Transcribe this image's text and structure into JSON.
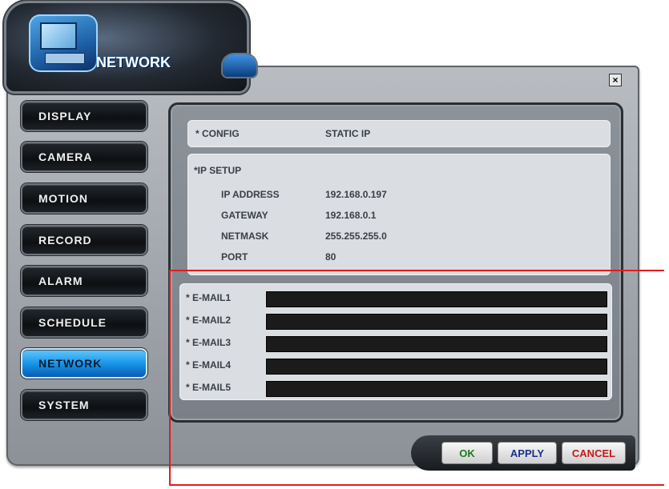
{
  "window": {
    "title": "NETWORK",
    "close_label": "×"
  },
  "sidebar": {
    "items": [
      {
        "label": "DISPLAY",
        "active": false
      },
      {
        "label": "CAMERA",
        "active": false
      },
      {
        "label": "MOTION",
        "active": false
      },
      {
        "label": "RECORD",
        "active": false
      },
      {
        "label": "ALARM",
        "active": false
      },
      {
        "label": "SCHEDULE",
        "active": false
      },
      {
        "label": "NETWORK",
        "active": true
      },
      {
        "label": "SYSTEM",
        "active": false
      }
    ]
  },
  "config": {
    "label": "* CONFIG",
    "value": "STATIC IP"
  },
  "ip_setup": {
    "heading": "*IP SETUP",
    "rows": [
      {
        "label": "IP ADDRESS",
        "value": "192.168.0.197"
      },
      {
        "label": "GATEWAY",
        "value": "192.168.0.1"
      },
      {
        "label": "NETMASK",
        "value": "255.255.255.0"
      },
      {
        "label": "PORT",
        "value": "80"
      }
    ]
  },
  "email": {
    "rows": [
      {
        "label": "* E-MAIL1",
        "value": ""
      },
      {
        "label": "* E-MAIL2",
        "value": ""
      },
      {
        "label": "* E-MAIL3",
        "value": ""
      },
      {
        "label": "* E-MAIL4",
        "value": ""
      },
      {
        "label": "* E-MAIL5",
        "value": ""
      }
    ]
  },
  "buttons": {
    "ok": "OK",
    "apply": "APPLY",
    "cancel": "CANCEL"
  },
  "colors": {
    "active_nav": "#1490e6",
    "ok_text": "#1a7a1a",
    "apply_text": "#1a2f8a",
    "cancel_text": "#c41a1a",
    "annotation": "#e51b1b"
  }
}
